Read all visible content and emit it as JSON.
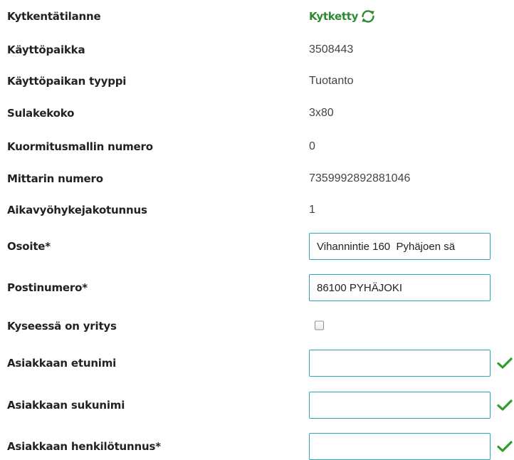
{
  "fields": {
    "connection_status": {
      "label": "Kytkentätilanne",
      "value": "Kytketty",
      "icon": "refresh-icon"
    },
    "usage_place": {
      "label": "Käyttöpaikka",
      "value": "3508443"
    },
    "usage_place_type": {
      "label": "Käyttöpaikan tyyppi",
      "value": "Tuotanto"
    },
    "fuse_size": {
      "label": "Sulakekoko",
      "value": "3x80"
    },
    "load_model_number": {
      "label": "Kuormitusmallin numero",
      "value": "0"
    },
    "meter_number": {
      "label": "Mittarin numero",
      "value": "7359992892881046"
    },
    "time_zone_code": {
      "label": "Aikavyöhykejakotunnus",
      "value": "1"
    },
    "address": {
      "label": "Osoite*",
      "value": "Vihannintie 160  Pyhäjoen sä"
    },
    "postal_code": {
      "label": "Postinumero*",
      "value": "86100 PYHÄJOKI"
    },
    "is_company": {
      "label": "Kyseessä on yritys",
      "checked": false
    },
    "first_name": {
      "label": "Asiakkaan etunimi",
      "value": "",
      "valid_icon": "checkmark-icon"
    },
    "last_name": {
      "label": "Asiakkaan sukunimi",
      "value": "",
      "valid_icon": "checkmark-icon"
    },
    "personal_id": {
      "label": "Asiakkaan henkilötunnus*",
      "value": "",
      "valid_icon": "checkmark-icon"
    }
  },
  "colors": {
    "status_green": "#2d8a32",
    "checkmark_green": "#2e9d2e",
    "input_border": "#2aa6b8",
    "label_text": "#222222",
    "value_text": "#444444"
  }
}
